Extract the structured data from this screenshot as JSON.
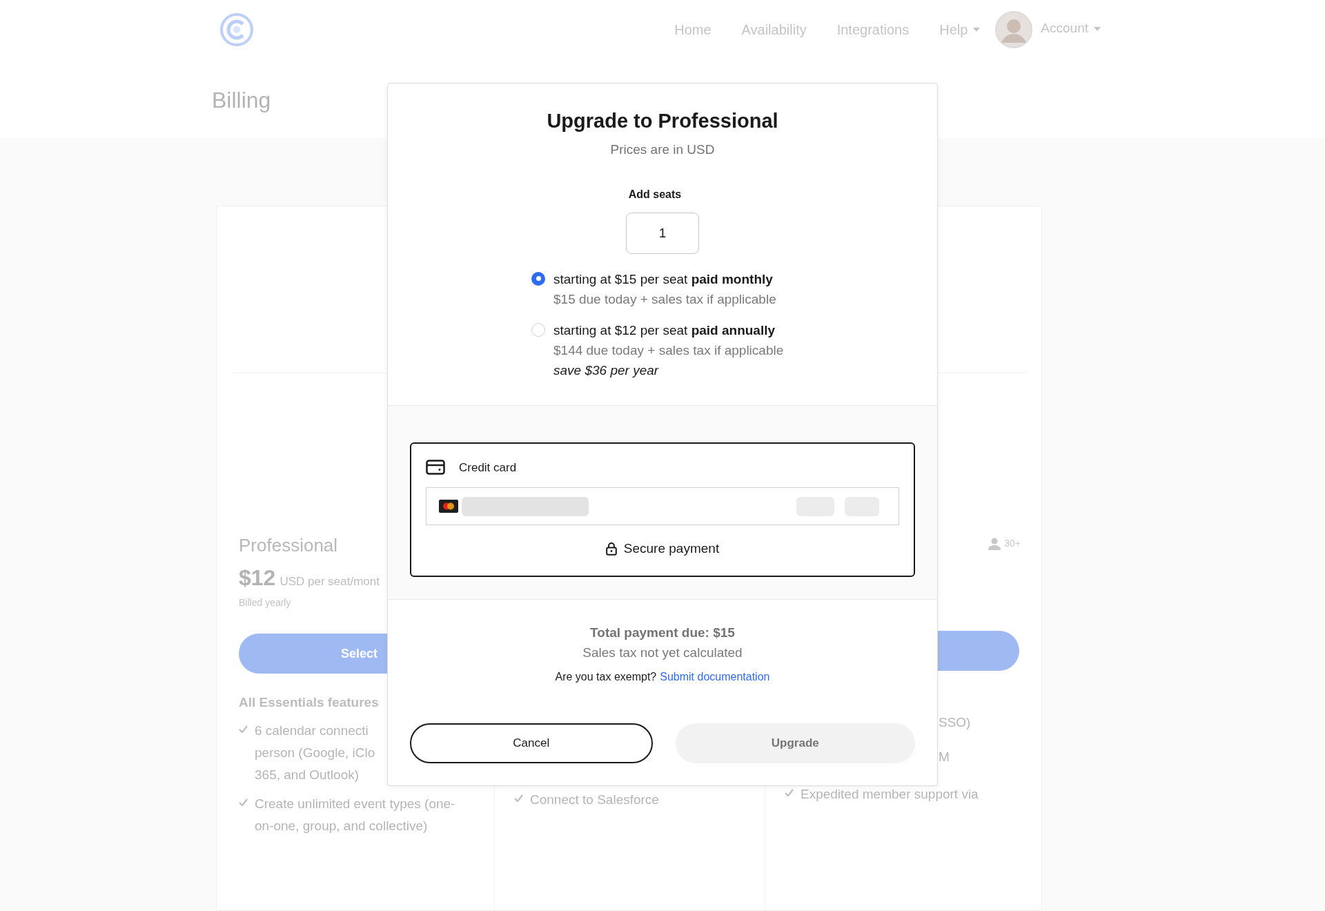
{
  "header": {
    "nav": [
      {
        "label": "Home",
        "has_menu": false
      },
      {
        "label": "Availability",
        "has_menu": false
      },
      {
        "label": "Integrations",
        "has_menu": false
      },
      {
        "label": "Help",
        "has_menu": true
      }
    ],
    "account": {
      "label": "Account",
      "has_menu": true
    }
  },
  "page": {
    "title": "Billing"
  },
  "plans": [
    {
      "name": "Professional",
      "price": "$12",
      "price_unit": "USD per seat/mont",
      "billing": "Billed yearly",
      "button": "Select",
      "features_title": "All Essentials features",
      "features": [
        {
          "lines": [
            "6 calendar connecti",
            "person (Google, iClo",
            "365, and Outlook)"
          ],
          "check": true
        },
        {
          "lines": [
            "Create unlimited event types (one-",
            "on-one, group, and collective)"
          ],
          "check": true
        }
      ]
    },
    {
      "features": [
        {
          "lines": [
            "Connect to Salesforce"
          ],
          "check": true
        }
      ]
    },
    {
      "seats": "30+",
      "features": [
        {
          "lines": [
            "SSO)"
          ],
          "check": false
        },
        {
          "lines": [
            "M"
          ],
          "check": false
        },
        {
          "lines": [
            "Expedited member support via"
          ],
          "check": true
        }
      ]
    }
  ],
  "modal": {
    "title": "Upgrade to Professional",
    "subtitle": "Prices are in USD",
    "seats": {
      "label": "Add seats",
      "value": "1"
    },
    "options": [
      {
        "selected": true,
        "headline": "starting at $15 per seat **paid monthly**",
        "detail": "$15 due today + sales tax if applicable"
      },
      {
        "selected": false,
        "headline": "starting at $12 per seat **paid annually**",
        "detail": "$144 due today + sales tax if applicable",
        "note": "save $36 per year"
      }
    ],
    "payment": {
      "method": "Credit card",
      "secure": "Secure payment"
    },
    "summary": {
      "total": "Total payment due: $15",
      "tax": "Sales tax not yet calculated",
      "exempt_question": "Are you tax exempt?",
      "exempt_link": "Submit documentation"
    },
    "buttons": [
      {
        "label": "Cancel",
        "kind": "secondary",
        "disabled": false
      },
      {
        "label": "Upgrade",
        "kind": "primary",
        "disabled": true
      }
    ]
  }
}
